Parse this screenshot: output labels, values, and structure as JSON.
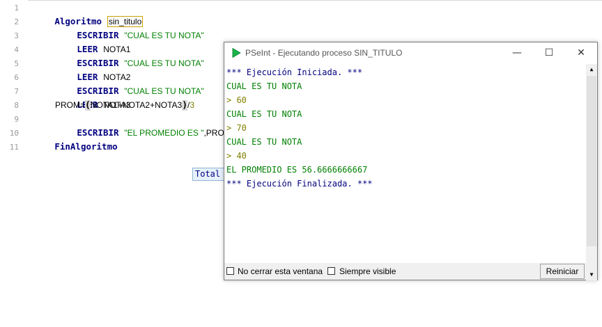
{
  "editor": {
    "line_numbers": [
      "1",
      "2",
      "3",
      "4",
      "5",
      "6",
      "7",
      "8",
      "9",
      "10",
      "11"
    ],
    "lines": [
      {
        "kw": "Algoritmo",
        "name": "sin_titulo"
      },
      {
        "kw": "ESCRIBIR",
        "str": "\"CUAL ES TU NOTA\""
      },
      {
        "kw": "LEER",
        "id": "NOTA1"
      },
      {
        "kw": "ESCRIBIR",
        "str": "\"CUAL ES TU NOTA\""
      },
      {
        "kw": "LEER",
        "id": "NOTA2"
      },
      {
        "kw": "ESCRIBIR",
        "str": "\"CUAL ES TU NOTA\""
      },
      {
        "kw": "LEER",
        "id": "NOTA3"
      },
      {
        "lhs": "PROM",
        "eq": "=",
        "open": "(",
        "expr": "NOTA1+NOTA2+NOTA3",
        "close": ")",
        "div": "/",
        "num": "3"
      },
      {
        "kw": "ESCRIBIR",
        "str": "\"EL PROMEDIO ES \"",
        "tail": ",PROM"
      },
      {
        "kw": "FinAlgoritmo"
      }
    ],
    "tooltip": "Total"
  },
  "window": {
    "title": "PSeInt - Ejecutando proceso SIN_TITULO",
    "minimize": "—",
    "maximize": "☐",
    "close": "✕",
    "console_lines": [
      {
        "text": "*** Ejecución Iniciada. ***",
        "color": "#00007f"
      },
      {
        "text": "CUAL ES TU NOTA",
        "color": "#007f00"
      },
      {
        "text": "> 60",
        "color": "#7f7f00"
      },
      {
        "text": "CUAL ES TU NOTA",
        "color": "#007f00"
      },
      {
        "text": "> 70",
        "color": "#7f7f00"
      },
      {
        "text": "CUAL ES TU NOTA",
        "color": "#007f00"
      },
      {
        "text": "> 40",
        "color": "#7f7f00"
      },
      {
        "text": "EL PROMEDIO ES 56.6666666667",
        "color": "#007f00"
      },
      {
        "text": "*** Ejecución Finalizada. ***",
        "color": "#00007f"
      }
    ],
    "checkbox_keep_open": "No cerrar esta ventana",
    "checkbox_always_visible": "Siempre visible",
    "restart_button": "Reiniciar",
    "scroll_up": "▲",
    "scroll_down": "▼"
  }
}
